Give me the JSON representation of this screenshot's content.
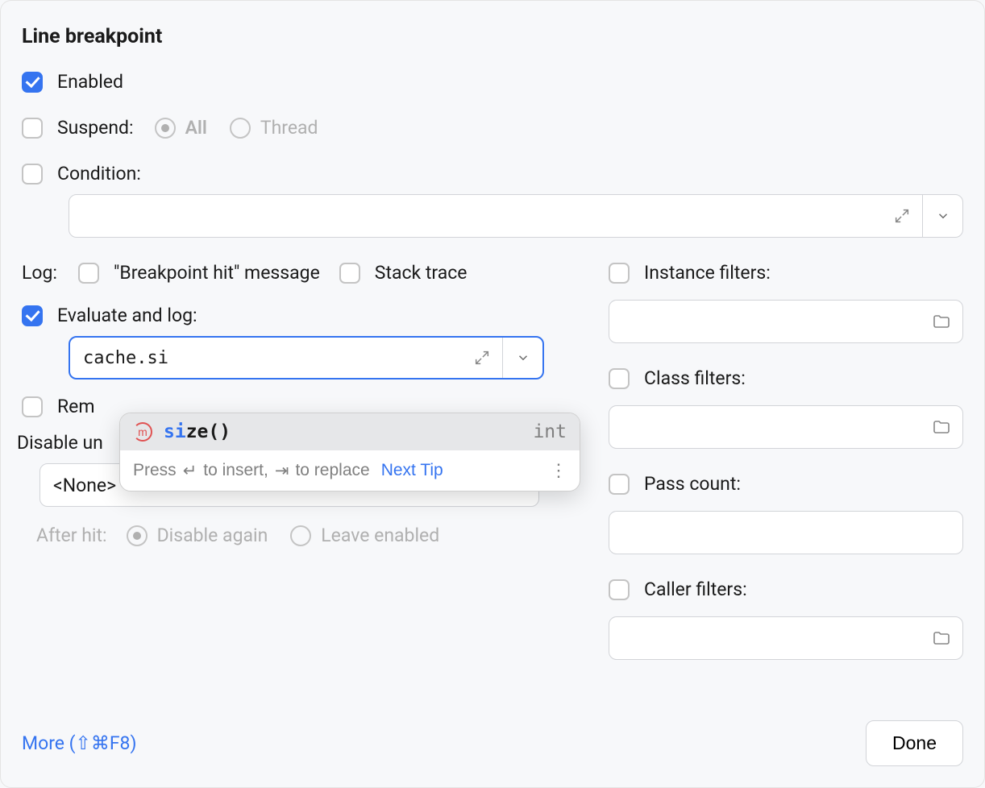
{
  "title": "Line breakpoint",
  "enabled": {
    "checked": true,
    "label": "Enabled"
  },
  "suspend": {
    "checked": false,
    "label": "Suspend:",
    "options": {
      "all": "All",
      "thread": "Thread"
    },
    "selected": "all"
  },
  "condition": {
    "checked": false,
    "label": "Condition:",
    "value": ""
  },
  "log": {
    "label": "Log:",
    "bp_hit": {
      "checked": false,
      "label": "\"Breakpoint hit\" message"
    },
    "stack_trace": {
      "checked": false,
      "label": "Stack trace"
    }
  },
  "eval_log": {
    "checked": true,
    "label": "Evaluate and log:",
    "value": "cache.si"
  },
  "remove_once_hit": {
    "checked": false,
    "label": "Rem"
  },
  "disable_until": {
    "label": "Disable un",
    "select_value": "<None>",
    "after_hit_label": "After hit:",
    "options": {
      "disable_again": "Disable again",
      "leave_enabled": "Leave enabled"
    },
    "selected": "disable_again"
  },
  "filters": {
    "instance": {
      "checked": false,
      "label": "Instance filters:"
    },
    "class": {
      "checked": false,
      "label": "Class filters:"
    },
    "pass": {
      "checked": false,
      "label": "Pass count:"
    },
    "caller": {
      "checked": false,
      "label": "Caller filters:"
    }
  },
  "autocomplete": {
    "icon": "m",
    "match": "si",
    "rest": "ze",
    "paren": "()",
    "type": "int",
    "hint_prefix": "Press",
    "hint_mid": "to insert,",
    "hint_suffix": "to replace",
    "next_tip": "Next Tip"
  },
  "footer": {
    "more": "More (⇧⌘F8)",
    "done": "Done"
  }
}
